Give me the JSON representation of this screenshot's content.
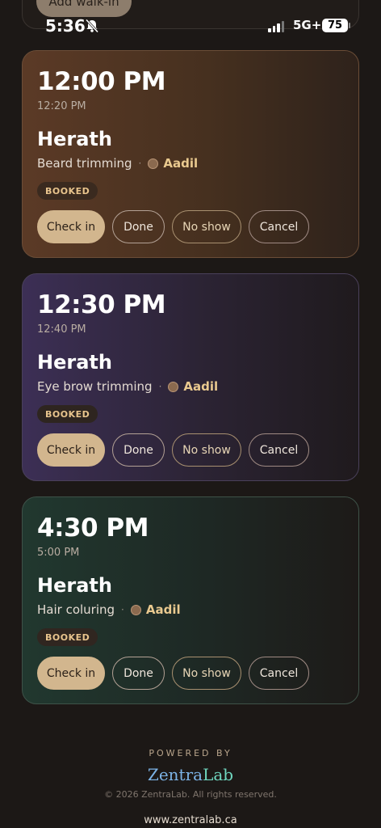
{
  "status_bar": {
    "time": "5:36",
    "network": "5G+",
    "battery": "75"
  },
  "previous_card": {
    "button_label": "Add walk-in"
  },
  "appointments": [
    {
      "start": "12:00 PM",
      "end": "12:20 PM",
      "client": "Herath",
      "service": "Beard trimming",
      "separator": "·",
      "staff": "Aadil",
      "status": "BOOKED",
      "actions": {
        "check_in": "Check in",
        "done": "Done",
        "no_show": "No show",
        "cancel": "Cancel"
      }
    },
    {
      "start": "12:30 PM",
      "end": "12:40 PM",
      "client": "Herath",
      "service": "Eye brow trimming",
      "separator": "·",
      "staff": "Aadil",
      "status": "BOOKED",
      "actions": {
        "check_in": "Check in",
        "done": "Done",
        "no_show": "No show",
        "cancel": "Cancel"
      }
    },
    {
      "start": "4:30 PM",
      "end": "5:00 PM",
      "client": "Herath",
      "service": "Hair coluring",
      "separator": "·",
      "staff": "Aadil",
      "status": "BOOKED",
      "actions": {
        "check_in": "Check in",
        "done": "Done",
        "no_show": "No show",
        "cancel": "Cancel"
      }
    }
  ],
  "footer": {
    "powered_by": "POWERED BY",
    "brand_part1": "Zentra",
    "brand_part2": "Lab",
    "copyright": "© 2026 ZentraLab. All rights reserved.",
    "website": "www.zentralab.ca"
  },
  "colors": {
    "background": "#1c1816",
    "primary_button": "#d2b68e",
    "staff_name": "#e9c98f",
    "badge_text": "#e8c48d"
  }
}
